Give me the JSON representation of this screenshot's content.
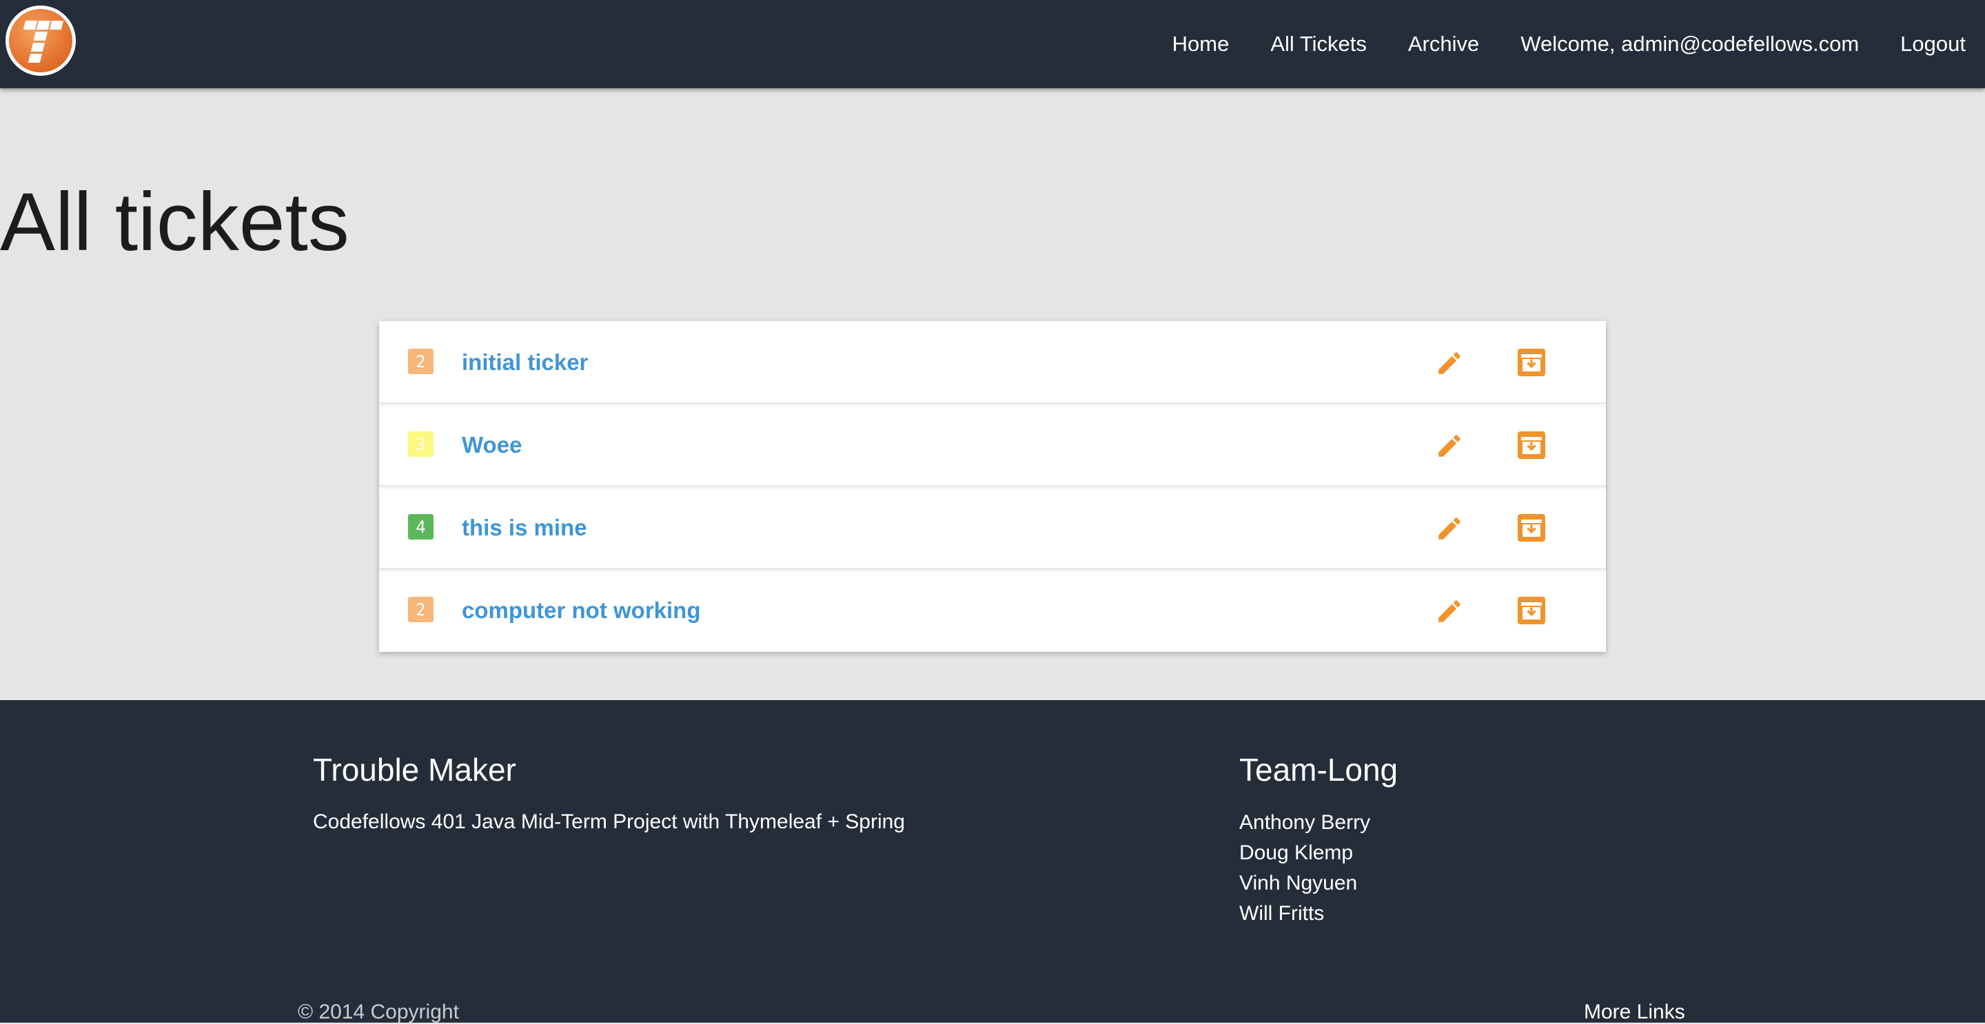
{
  "nav": {
    "links": [
      "Home",
      "All Tickets",
      "Archive",
      "Welcome, admin@codefellows.com",
      "Logout"
    ]
  },
  "page": {
    "title": "All tickets"
  },
  "tickets": [
    {
      "priority": "2",
      "priority_color": "#f7b77a",
      "title": "initial ticker"
    },
    {
      "priority": "3",
      "priority_color": "#fbf97e",
      "title": "Woee"
    },
    {
      "priority": "4",
      "priority_color": "#5cb85c",
      "title": "this is mine"
    },
    {
      "priority": "2",
      "priority_color": "#f7b77a",
      "title": "computer not working"
    }
  ],
  "colors": {
    "navbar": "#252d3b",
    "accent_orange": "#f0932b",
    "link_blue": "#3f95d6",
    "page_bg": "#e5e5e5"
  },
  "icons": {
    "logo": "trouble-maker-logo-icon",
    "edit": "pencil-icon",
    "archive": "archive-box-icon"
  },
  "footer": {
    "brand_title": "Trouble Maker",
    "brand_desc": "Codefellows 401 Java Mid-Term Project with Thymeleaf + Spring",
    "team_title": "Team-Long",
    "team_members": [
      "Anthony Berry",
      "Doug Klemp",
      "Vinh Ngyuen",
      "Will Fritts"
    ],
    "copyright": "© 2014 Copyright",
    "more_links": "More Links"
  }
}
